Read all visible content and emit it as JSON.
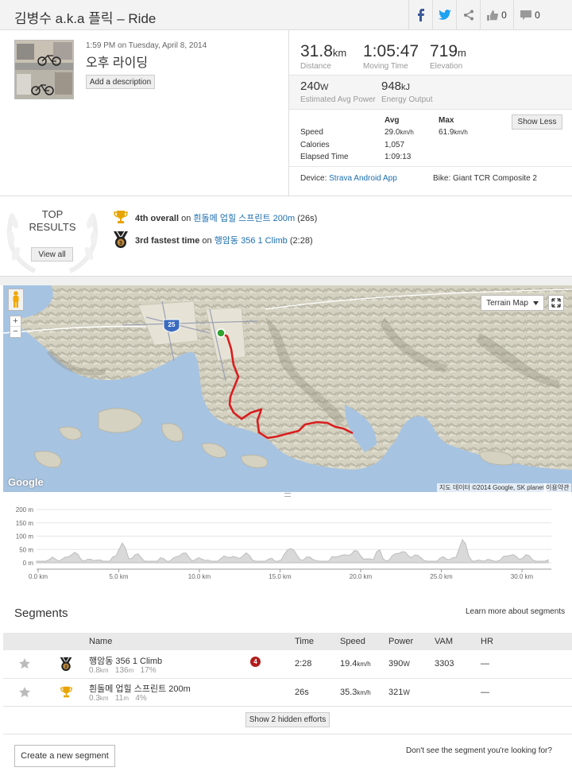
{
  "header": {
    "athlete": "김병수 a.k.a 플릭",
    "activity_type": "Ride",
    "title": "김병수 a.k.a 플릭 – Ride",
    "kudos_count": "0",
    "comment_count": "0"
  },
  "activity": {
    "datetime": "1:59 PM on Tuesday, April 8, 2014",
    "name": "오후 라이딩",
    "add_description": "Add a description"
  },
  "stats": {
    "distance": {
      "value": "31.8",
      "unit": "km",
      "label": "Distance"
    },
    "moving_time": {
      "value": "1:05:47",
      "label": "Moving Time"
    },
    "elevation": {
      "value": "719",
      "unit": "m",
      "label": "Elevation"
    },
    "power": {
      "value": "240",
      "unit": "W",
      "label": "Estimated Avg Power"
    },
    "energy": {
      "value": "948",
      "unit": "kJ",
      "label": "Energy Output"
    }
  },
  "details": {
    "avg_header": "Avg",
    "max_header": "Max",
    "show_less": "Show Less",
    "speed_label": "Speed",
    "speed_avg": "29.0",
    "speed_max": "61.9",
    "speed_unit": "km/h",
    "calories_label": "Calories",
    "calories": "1,057",
    "elapsed_label": "Elapsed Time",
    "elapsed": "1:09:13",
    "device_label": "Device:",
    "device": "Strava Android App",
    "bike_label": "Bike:",
    "bike": "Giant TCR Composite 2"
  },
  "top_results": {
    "title_line1": "TOP",
    "title_line2": "RESULTS",
    "view_all": "View all",
    "items": [
      {
        "rank": "4th overall",
        "on": "on",
        "segment": "흰돌메 업힐 스프린트 200m",
        "time": "(26s)"
      },
      {
        "rank": "3rd fastest time",
        "on": "on",
        "segment": "행암동 356 1 Climb",
        "time": "(2:28)"
      }
    ]
  },
  "map": {
    "type_selector": "Terrain Map",
    "attribution": "지도 데이터 ©2014 Google, SK planet",
    "terms": "이용약관",
    "logo": "Google",
    "road_badge": "25",
    "zoom_in": "+",
    "zoom_out": "−"
  },
  "elevation_chart": {
    "y_ticks": [
      "200 m",
      "150 m",
      "100 m",
      "50 m",
      "0 m"
    ],
    "x_ticks": [
      "0.0 km",
      "5.0 km",
      "10.0 km",
      "15.0 km",
      "20.0 km",
      "25.0 km",
      "30.0 km"
    ]
  },
  "segments": {
    "title": "Segments",
    "learn_more": "Learn more about segments",
    "columns": [
      "Name",
      "Time",
      "Speed",
      "Power",
      "VAM",
      "HR"
    ],
    "rows": [
      {
        "name": "행암동 356 1 Climb",
        "distance": "0.8",
        "distance_unit": "km",
        "elev": "136",
        "elev_unit": "m",
        "grade": "17%",
        "badge": "4",
        "time": "2:28",
        "speed": "19.4",
        "speed_unit": "km/h",
        "power": "390",
        "power_unit": "W",
        "vam": "3303",
        "hr": "—"
      },
      {
        "name": "흰돌메 업힐 스프린트 200m",
        "distance": "0.3",
        "distance_unit": "km",
        "elev": "11",
        "elev_unit": "m",
        "grade": "4%",
        "time": "26s",
        "speed": "35.3",
        "speed_unit": "km/h",
        "power": "321",
        "power_unit": "W",
        "vam": "",
        "hr": "—"
      }
    ],
    "hidden_efforts": "Show 2 hidden efforts",
    "create_segment": "Create a new segment",
    "not_found": "Don't see the segment you're looking for?"
  },
  "colors": {
    "route": "#d91e1e",
    "link": "#1b6eb0",
    "facebook": "#3b5998",
    "twitter": "#1da1f2",
    "gold": "#e8a400"
  }
}
